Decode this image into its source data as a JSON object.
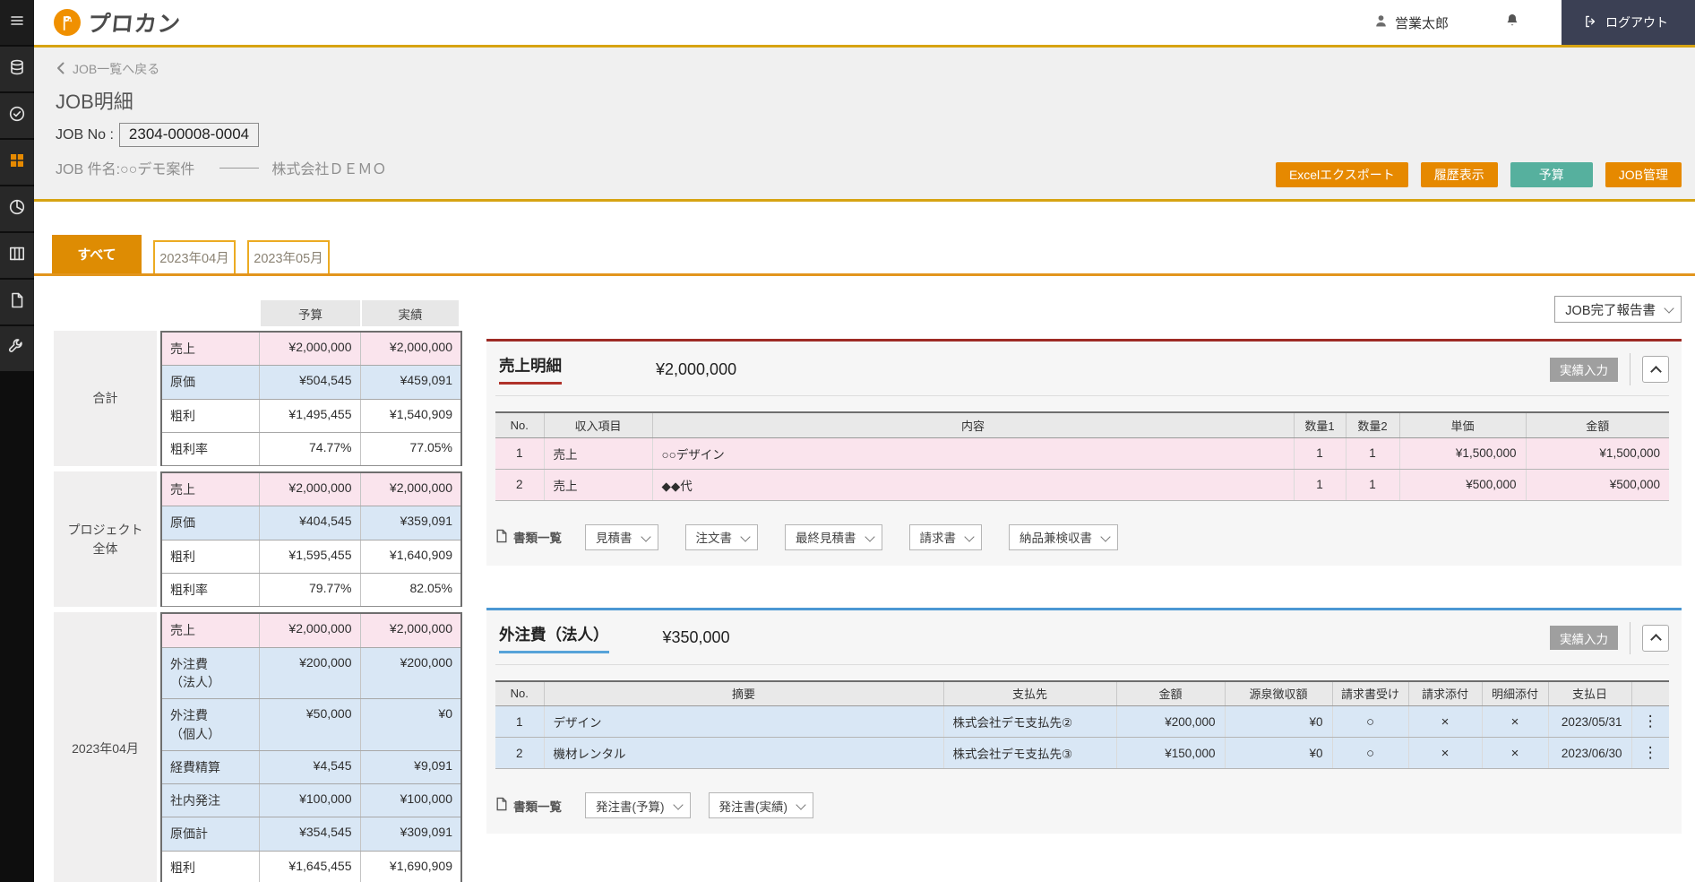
{
  "topbar": {
    "logo_text": "プロカン",
    "user_name": "営業太郎",
    "logout_label": "ログアウト"
  },
  "header": {
    "back_link": "JOB一覧へ戻る",
    "title": "JOB明細",
    "job_no_label": "JOB No :",
    "job_no": "2304-00008-0004",
    "job_title_label": "JOB 件名:○○デモ案件",
    "client": "株式会社ＤＥＭＯ",
    "buttons": {
      "excel": "Excelエクスポート",
      "history": "履歴表示",
      "budget": "予算",
      "job_manage": "JOB管理"
    }
  },
  "tabs": [
    {
      "label": "すべて",
      "active": true
    },
    {
      "label": "2023年04月",
      "active": false
    },
    {
      "label": "2023年05月",
      "active": false
    }
  ],
  "report_select": "JOB完了報告書",
  "summary": {
    "headers": [
      "予算",
      "実績"
    ],
    "groups": [
      {
        "label": "合計",
        "rows": [
          {
            "item": "売上",
            "budget": "¥2,000,000",
            "actual": "¥2,000,000"
          },
          {
            "item": "原価",
            "budget": "¥504,545",
            "actual": "¥459,091"
          },
          {
            "item": "粗利",
            "budget": "¥1,495,455",
            "actual": "¥1,540,909"
          },
          {
            "item": "粗利率",
            "budget": "74.77%",
            "actual": "77.05%"
          }
        ]
      },
      {
        "label": "プロジェクト\n全体",
        "rows": [
          {
            "item": "売上",
            "budget": "¥2,000,000",
            "actual": "¥2,000,000"
          },
          {
            "item": "原価",
            "budget": "¥404,545",
            "actual": "¥359,091"
          },
          {
            "item": "粗利",
            "budget": "¥1,595,455",
            "actual": "¥1,640,909"
          },
          {
            "item": "粗利率",
            "budget": "79.77%",
            "actual": "82.05%"
          }
        ]
      },
      {
        "label": "2023年04月",
        "rows": [
          {
            "item": "売上",
            "budget": "¥2,000,000",
            "actual": "¥2,000,000"
          },
          {
            "item": "外注費\n（法人）",
            "budget": "¥200,000",
            "actual": "¥200,000"
          },
          {
            "item": "外注費\n（個人）",
            "budget": "¥50,000",
            "actual": "¥0"
          },
          {
            "item": "経費精算",
            "budget": "¥4,545",
            "actual": "¥9,091"
          },
          {
            "item": "社内発注",
            "budget": "¥100,000",
            "actual": "¥100,000"
          },
          {
            "item": "原価計",
            "budget": "¥354,545",
            "actual": "¥309,091"
          },
          {
            "item": "粗利",
            "budget": "¥1,645,455",
            "actual": "¥1,690,909"
          }
        ]
      }
    ]
  },
  "sales": {
    "title": "売上明細",
    "total": "¥2,000,000",
    "actual_input": "実績入力",
    "columns": [
      "No.",
      "収入項目",
      "内容",
      "数量1",
      "数量2",
      "単価",
      "金額"
    ],
    "rows": [
      [
        "1",
        "売上",
        "○○デザイン",
        "1",
        "1",
        "¥1,500,000",
        "¥1,500,000"
      ],
      [
        "2",
        "売上",
        "◆◆代",
        "1",
        "1",
        "¥500,000",
        "¥500,000"
      ]
    ],
    "docs_label": "書類一覧",
    "docs": [
      "見積書",
      "注文書",
      "最終見積書",
      "請求書",
      "納品兼検収書"
    ]
  },
  "outsourcing": {
    "title": "外注費（法人）",
    "total": "¥350,000",
    "actual_input": "実績入力",
    "columns": [
      "No.",
      "摘要",
      "支払先",
      "金額",
      "源泉徴収額",
      "請求書受け",
      "請求添付",
      "明細添付",
      "支払日"
    ],
    "rows": [
      [
        "1",
        "デザイン",
        "株式会社デモ支払先②",
        "¥200,000",
        "¥0",
        "○",
        "×",
        "×",
        "2023/05/31"
      ],
      [
        "2",
        "機材レンタル",
        "株式会社デモ支払先③",
        "¥150,000",
        "¥0",
        "○",
        "×",
        "×",
        "2023/06/30"
      ]
    ],
    "docs_label": "書類一覧",
    "docs": [
      "発注書(予算)",
      "発注書(実績)"
    ]
  },
  "colors": {
    "accent_orange": "#e68900",
    "gold_line": "#d7a312",
    "teal_button": "#56b09e",
    "logout_bg": "#3b4054",
    "section_red": "#9e2b25",
    "section_blue": "#4b98d3",
    "row_pink": "#fae4ed",
    "row_blue": "#d9e7f5"
  },
  "icons": {
    "menu-icon": "☰",
    "coins-icon": "stacked-coins",
    "check-circle-icon": "✓",
    "grid-icon": "⊞",
    "pie-chart-icon": "pie",
    "columns-icon": "columns",
    "file-icon": "file",
    "wrench-icon": "wrench",
    "user-icon": "person",
    "bell-icon": "bell",
    "logout-icon": "door-arrow",
    "back-chevron-icon": "‹",
    "docs-file-icon": "file",
    "kebab-icon": "⋮",
    "chevron-down-icon": "v",
    "chevron-up-icon": "^"
  }
}
